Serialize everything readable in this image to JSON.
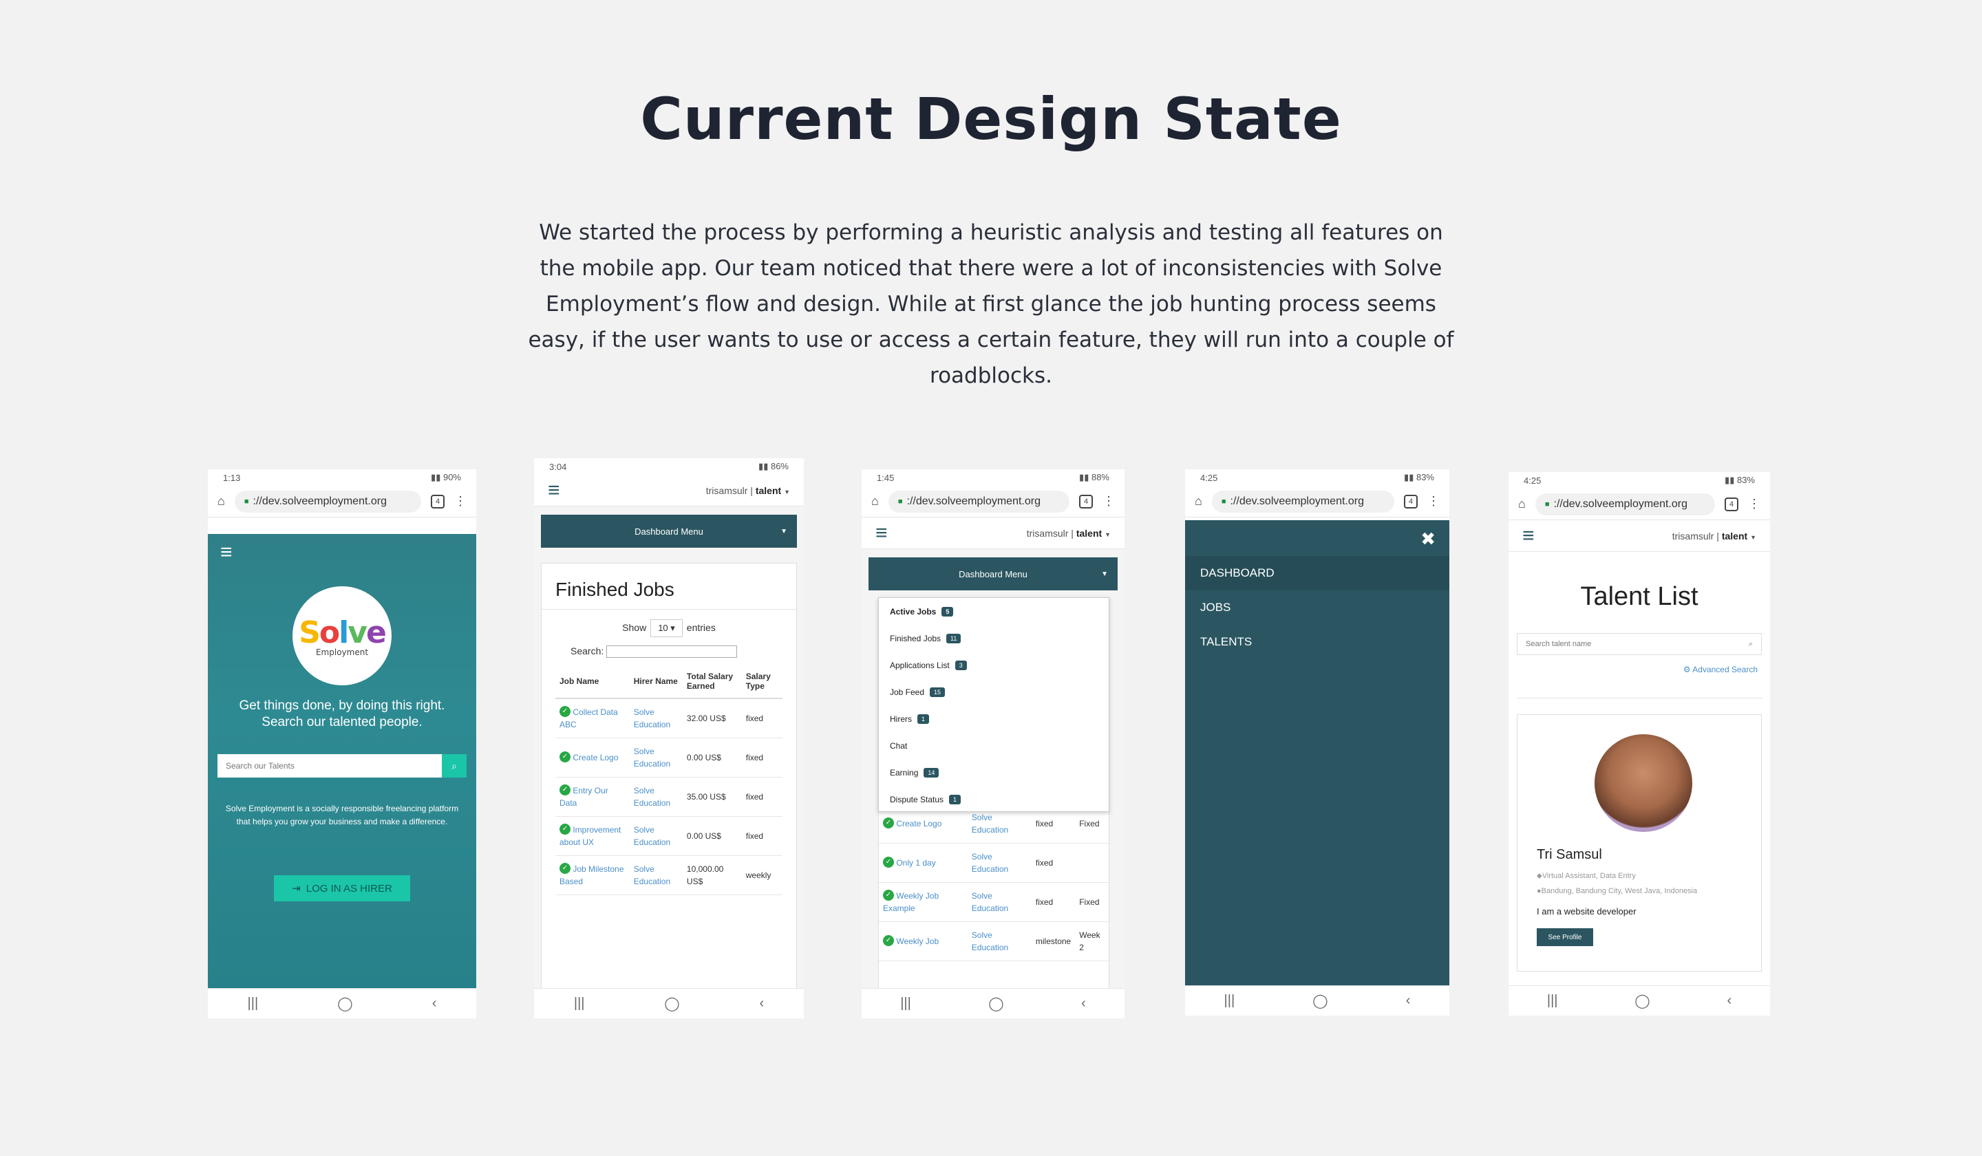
{
  "heading": "Current Design State",
  "intro": "We started the process by performing a heuristic analysis and testing all features on the mobile app. Our team noticed that there were a lot of inconsistencies with Solve Employment’s flow and design. While at first glance the job hunting process seems easy, if the user wants to use or access a certain feature, they will run into a couple of roadblocks.",
  "url_text": "://dev.solveemployment.org",
  "tab_count": "4",
  "user": {
    "name": "trisamsulr",
    "sep": " | ",
    "role": "talent"
  },
  "dashboard_menu_label": "Dashboard Menu",
  "nav_icons": {
    "recent": "|||",
    "home": "◯",
    "back": "‹"
  },
  "phone1": {
    "status_time": "1:13",
    "status_battery": "90%",
    "logo_word": "Solve",
    "logo_sub": "Employment",
    "tagline": "Get things done, by doing this right. Search our talented people.",
    "search_placeholder": "Search our Talents",
    "description": "Solve Employment is a socially responsible freelancing platform that helps you grow your business and make a difference.",
    "hirer_button": "LOG IN AS HIRER"
  },
  "phone2": {
    "status_time": "3:04",
    "status_battery": "86%",
    "card_title": "Finished Jobs",
    "show_label": "Show",
    "entries_value": "10",
    "entries_label": "entries",
    "search_label": "Search:",
    "columns": [
      "Job Name",
      "Hirer Name",
      "Total Salary Earned",
      "Salary Type"
    ],
    "rows": [
      {
        "job": "Collect Data ABC",
        "hirer": "Solve Education",
        "salary": "32.00 US$",
        "type": "fixed"
      },
      {
        "job": "Create Logo",
        "hirer": "Solve Education",
        "salary": "0.00 US$",
        "type": "fixed"
      },
      {
        "job": "Entry Our Data",
        "hirer": "Solve Education",
        "salary": "35.00 US$",
        "type": "fixed"
      },
      {
        "job": "Improvement about UX",
        "hirer": "Solve Education",
        "salary": "0.00 US$",
        "type": "fixed"
      },
      {
        "job": "Job Milestone Based",
        "hirer": "Solve Education",
        "salary": "10,000.00 US$",
        "type": "weekly"
      }
    ]
  },
  "phone3": {
    "status_time": "1:45",
    "status_battery": "88%",
    "menu": [
      {
        "label": "Active Jobs",
        "badge": "5"
      },
      {
        "label": "Finished Jobs",
        "badge": "11"
      },
      {
        "label": "Applications List",
        "badge": "3"
      },
      {
        "label": "Job Feed",
        "badge": "15"
      },
      {
        "label": "Hirers",
        "badge": "1"
      },
      {
        "label": "Chat",
        "badge": ""
      },
      {
        "label": "Earning",
        "badge": "14"
      },
      {
        "label": "Dispute Status",
        "badge": "1"
      }
    ],
    "rows": [
      {
        "job": "Create Logo",
        "hirer": "Solve Education",
        "c3": "fixed",
        "c4": "Fixed"
      },
      {
        "job": "Only 1 day",
        "hirer": "Solve Education",
        "c3": "fixed",
        "c4": ""
      },
      {
        "job": "Weekly Job Example",
        "hirer": "Solve Education",
        "c3": "fixed",
        "c4": "Fixed"
      },
      {
        "job": "Weekly Job",
        "hirer": "Solve Education",
        "c3": "milestone",
        "c4": "Week 2"
      }
    ]
  },
  "phone4": {
    "status_time": "4:25",
    "status_battery": "83%",
    "items": [
      "DASHBOARD",
      "JOBS",
      "TALENTS"
    ]
  },
  "phone5": {
    "status_time": "4:25",
    "status_battery": "83%",
    "title": "Talent List",
    "search_placeholder": "Search talent name",
    "advanced_search": "Advanced Search",
    "talent_name": "Tri Samsul",
    "talent_skills": "Virtual Assistant, Data Entry",
    "talent_location": "Bandung, Bandung City, West Java, Indonesia",
    "talent_bio": "I am a website developer",
    "see_profile": "See Profile"
  },
  "colors": {
    "teal_dark": "#2b5661",
    "teal_hero": "#2e8a92",
    "accent_green": "#1bc5a8",
    "link_blue": "#4a8fc9",
    "text_dark": "#1f2433",
    "background": "#f2f2f2"
  }
}
